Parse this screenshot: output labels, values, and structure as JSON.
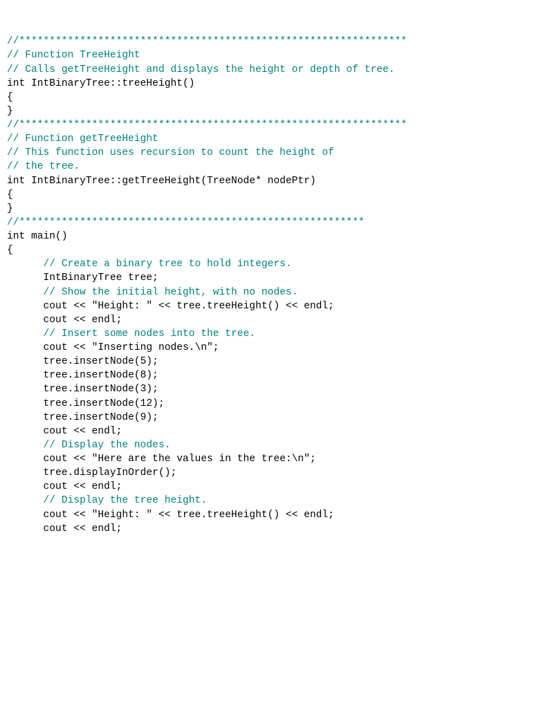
{
  "lines": [
    {
      "segs": [
        {
          "cls": "c",
          "t": "//****************************************************************"
        }
      ]
    },
    {
      "segs": [
        {
          "cls": "c",
          "t": "// Function TreeHeight"
        }
      ]
    },
    {
      "segs": [
        {
          "cls": "c",
          "t": "// Calls getTreeHeight and displays the height or depth of tree."
        }
      ]
    },
    {
      "segs": [
        {
          "cls": "k",
          "t": ""
        }
      ]
    },
    {
      "segs": [
        {
          "cls": "k",
          "t": "int IntBinaryTree::treeHeight()"
        }
      ]
    },
    {
      "segs": [
        {
          "cls": "k",
          "t": "{"
        }
      ]
    },
    {
      "segs": [
        {
          "cls": "k",
          "t": ""
        }
      ]
    },
    {
      "segs": [
        {
          "cls": "k",
          "t": ""
        }
      ]
    },
    {
      "segs": [
        {
          "cls": "k",
          "t": "}"
        }
      ]
    },
    {
      "segs": [
        {
          "cls": "k",
          "t": ""
        }
      ]
    },
    {
      "segs": [
        {
          "cls": "c",
          "t": "//****************************************************************"
        }
      ]
    },
    {
      "segs": [
        {
          "cls": "c",
          "t": "// Function getTreeHeight"
        }
      ]
    },
    {
      "segs": [
        {
          "cls": "c",
          "t": "// This function uses recursion to count the height of"
        }
      ]
    },
    {
      "segs": [
        {
          "cls": "c",
          "t": "// the tree."
        }
      ]
    },
    {
      "segs": [
        {
          "cls": "k",
          "t": ""
        }
      ]
    },
    {
      "segs": [
        {
          "cls": "k",
          "t": "int IntBinaryTree::getTreeHeight(TreeNode* nodePtr)"
        }
      ]
    },
    {
      "segs": [
        {
          "cls": "k",
          "t": "{"
        }
      ]
    },
    {
      "segs": [
        {
          "cls": "k",
          "t": ""
        }
      ]
    },
    {
      "segs": [
        {
          "cls": "k",
          "t": "}"
        }
      ]
    },
    {
      "segs": [
        {
          "cls": "k",
          "t": ""
        }
      ]
    },
    {
      "segs": [
        {
          "cls": "c",
          "t": "//*********************************************************"
        }
      ]
    },
    {
      "segs": [
        {
          "cls": "k",
          "t": "int main()"
        }
      ]
    },
    {
      "segs": [
        {
          "cls": "k",
          "t": "{"
        }
      ]
    },
    {
      "segs": [
        {
          "cls": "k",
          "t": ""
        }
      ]
    },
    {
      "segs": [
        {
          "cls": "k",
          "t": "      "
        },
        {
          "cls": "c",
          "t": "// Create a binary tree to hold integers."
        }
      ]
    },
    {
      "segs": [
        {
          "cls": "k",
          "t": "      IntBinaryTree tree;"
        }
      ]
    },
    {
      "segs": [
        {
          "cls": "k",
          "t": ""
        }
      ]
    },
    {
      "segs": [
        {
          "cls": "k",
          "t": "      "
        },
        {
          "cls": "c",
          "t": "// Show the initial height, with no nodes."
        }
      ]
    },
    {
      "segs": [
        {
          "cls": "k",
          "t": "      cout << \"Height: \" << tree.treeHeight() << endl;"
        }
      ]
    },
    {
      "segs": [
        {
          "cls": "k",
          "t": "      cout << endl;"
        }
      ]
    },
    {
      "segs": [
        {
          "cls": "k",
          "t": ""
        }
      ]
    },
    {
      "segs": [
        {
          "cls": "k",
          "t": "      "
        },
        {
          "cls": "c",
          "t": "// Insert some nodes into the tree."
        }
      ]
    },
    {
      "segs": [
        {
          "cls": "k",
          "t": "      cout << \"Inserting nodes.\\n\";"
        }
      ]
    },
    {
      "segs": [
        {
          "cls": "k",
          "t": "      tree.insertNode(5);"
        }
      ]
    },
    {
      "segs": [
        {
          "cls": "k",
          "t": "      tree.insertNode(8);"
        }
      ]
    },
    {
      "segs": [
        {
          "cls": "k",
          "t": "      tree.insertNode(3);"
        }
      ]
    },
    {
      "segs": [
        {
          "cls": "k",
          "t": "      tree.insertNode(12);"
        }
      ]
    },
    {
      "segs": [
        {
          "cls": "k",
          "t": "      tree.insertNode(9);"
        }
      ]
    },
    {
      "segs": [
        {
          "cls": "k",
          "t": "      cout << endl;"
        }
      ]
    },
    {
      "segs": [
        {
          "cls": "k",
          "t": ""
        }
      ]
    },
    {
      "segs": [
        {
          "cls": "k",
          "t": "      "
        },
        {
          "cls": "c",
          "t": "// Display the nodes."
        }
      ]
    },
    {
      "segs": [
        {
          "cls": "k",
          "t": "      cout << \"Here are the values in the tree:\\n\";"
        }
      ]
    },
    {
      "segs": [
        {
          "cls": "k",
          "t": "      tree.displayInOrder();"
        }
      ]
    },
    {
      "segs": [
        {
          "cls": "k",
          "t": "      cout << endl;"
        }
      ]
    },
    {
      "segs": [
        {
          "cls": "k",
          "t": ""
        }
      ]
    },
    {
      "segs": [
        {
          "cls": "k",
          "t": "      "
        },
        {
          "cls": "c",
          "t": "// Display the tree height."
        }
      ]
    },
    {
      "segs": [
        {
          "cls": "k",
          "t": "      cout << \"Height: \" << tree.treeHeight() << endl;"
        }
      ]
    },
    {
      "segs": [
        {
          "cls": "k",
          "t": "      cout << endl;"
        }
      ]
    }
  ]
}
